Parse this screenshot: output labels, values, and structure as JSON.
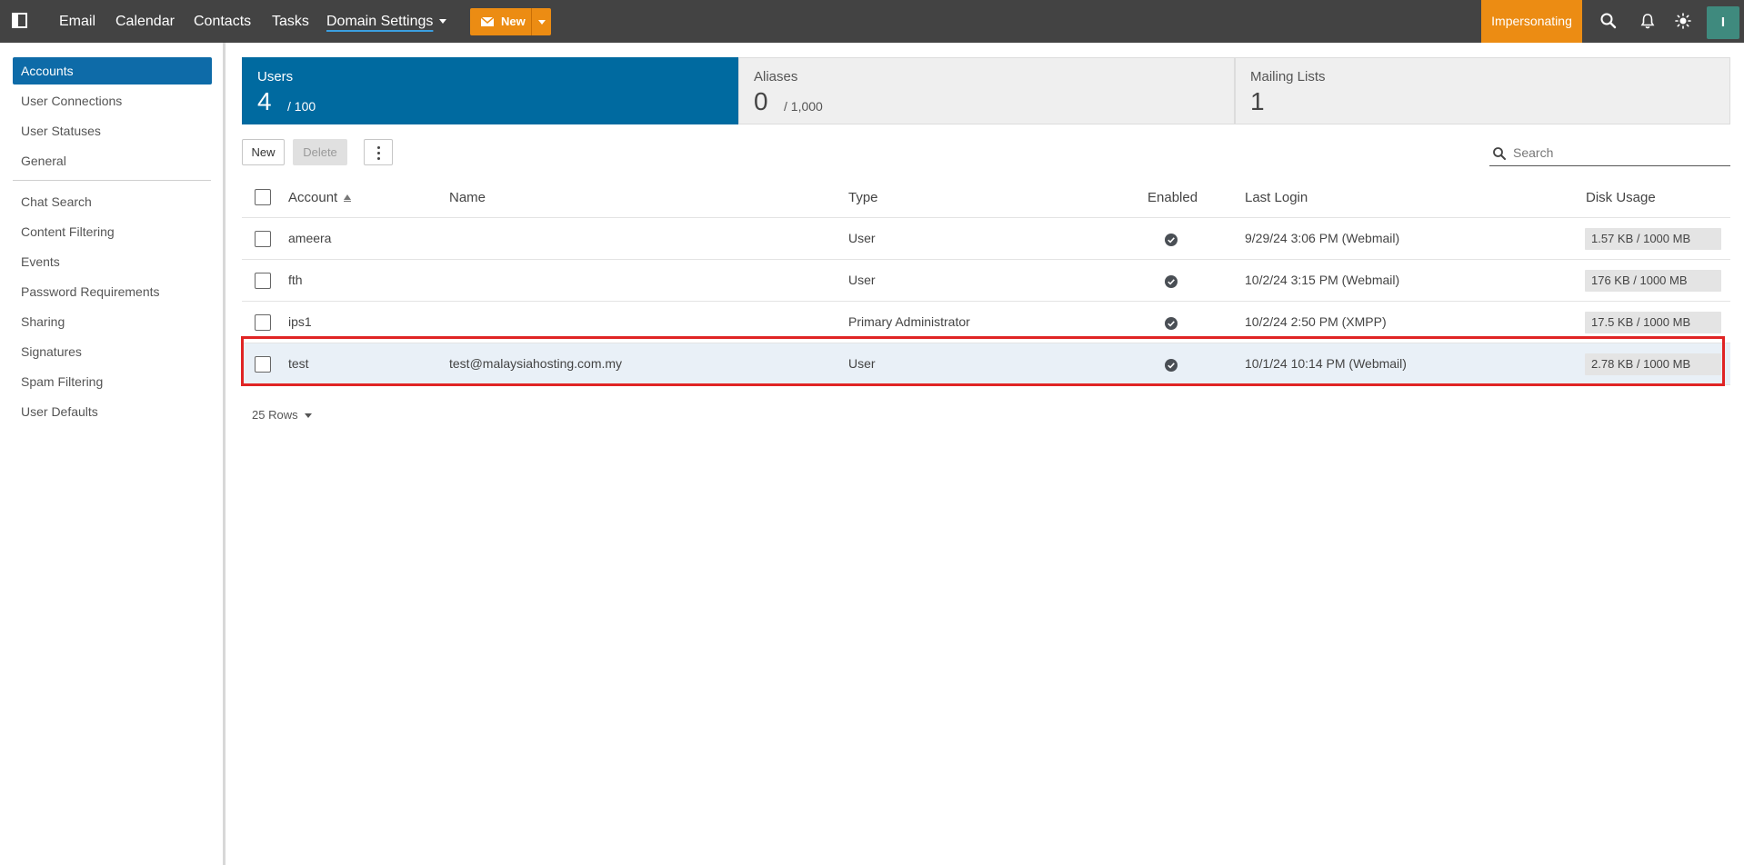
{
  "topbar": {
    "nav": [
      {
        "label": "Email"
      },
      {
        "label": "Calendar"
      },
      {
        "label": "Contacts"
      },
      {
        "label": "Tasks"
      },
      {
        "label": "Domain Settings"
      }
    ],
    "new_label": "New",
    "impersonating_label": "Impersonating",
    "avatar_initial": "I",
    "accent_color": "#ec8c13",
    "bar_color": "#434343"
  },
  "sidebar": {
    "items": [
      {
        "label": "Accounts",
        "active": true
      },
      {
        "label": "User Connections"
      },
      {
        "label": "User Statuses"
      },
      {
        "label": "General"
      },
      {
        "label": "Chat Search"
      },
      {
        "label": "Content Filtering"
      },
      {
        "label": "Events"
      },
      {
        "label": "Password Requirements"
      },
      {
        "label": "Sharing"
      },
      {
        "label": "Signatures"
      },
      {
        "label": "Spam Filtering"
      },
      {
        "label": "User Defaults"
      }
    ],
    "active_color": "#0e6ba8"
  },
  "stats": [
    {
      "label": "Users",
      "value": "4",
      "limit": "/ 100"
    },
    {
      "label": "Aliases",
      "value": "0",
      "limit": "/ 1,000"
    },
    {
      "label": "Mailing Lists",
      "value": "1",
      "limit": ""
    }
  ],
  "toolbar": {
    "new_label": "New",
    "delete_label": "Delete",
    "search_placeholder": "Search"
  },
  "table": {
    "columns": [
      "Account",
      "Name",
      "Type",
      "Enabled",
      "Last Login",
      "Disk Usage"
    ],
    "rows": [
      {
        "account": "ameera",
        "name": "",
        "type": "User",
        "enabled": true,
        "last_login": "9/29/24 3:06 PM (Webmail)",
        "disk": "1.57 KB / 1000 MB"
      },
      {
        "account": "fth",
        "name": "",
        "type": "User",
        "enabled": true,
        "last_login": "10/2/24 3:15 PM (Webmail)",
        "disk": "176 KB / 1000 MB"
      },
      {
        "account": "ips1",
        "name": "",
        "type": "Primary Administrator",
        "enabled": true,
        "last_login": "10/2/24 2:50 PM (XMPP)",
        "disk": "17.5 KB / 1000 MB"
      },
      {
        "account": "test",
        "name": "test@malaysiahosting.com.my",
        "type": "User",
        "enabled": true,
        "last_login": "10/1/24 10:14 PM (Webmail)",
        "disk": "2.78 KB / 1000 MB",
        "selected": true
      }
    ],
    "rows_per_page": "25 Rows"
  }
}
